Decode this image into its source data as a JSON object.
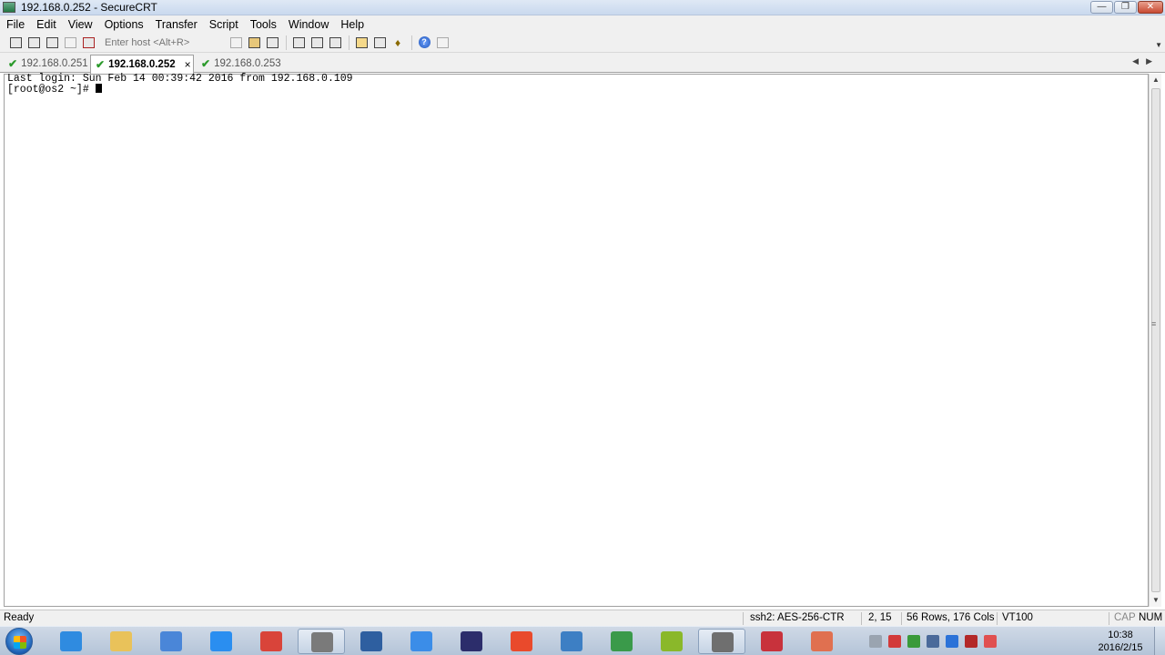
{
  "window": {
    "title": "192.168.0.252 - SecureCRT"
  },
  "menu": [
    "File",
    "Edit",
    "View",
    "Options",
    "Transfer",
    "Script",
    "Tools",
    "Window",
    "Help"
  ],
  "toolbar": {
    "host_placeholder": "Enter host <Alt+R>"
  },
  "tabs": [
    {
      "label": "192.168.0.251",
      "active": false
    },
    {
      "label": "192.168.0.252",
      "active": true,
      "close": "×"
    },
    {
      "label": "192.168.0.253",
      "active": false
    }
  ],
  "terminal": {
    "lines": [
      "Last login: Sun Feb 14 00:39:42 2016 from 192.168.0.109",
      "[root@os2 ~]# "
    ]
  },
  "status": {
    "ready": "Ready",
    "cipher": "ssh2: AES-256-CTR",
    "position": "2,  15",
    "size": "56 Rows, 176 Cols",
    "emulation": "VT100",
    "cap": "CAP",
    "num": "NUM"
  },
  "clock": {
    "time": "10:38",
    "date": "2016/2/15"
  },
  "taskbar_apps": [
    {
      "name": "ie-icon",
      "color": "#2f8be0",
      "open": false
    },
    {
      "name": "explorer-icon",
      "color": "#e9c25a",
      "open": false
    },
    {
      "name": "media-player-icon",
      "color": "#4a86d8",
      "open": false
    },
    {
      "name": "baidu-cloud-icon",
      "color": "#2a8ef0",
      "open": false
    },
    {
      "name": "chrome-icon",
      "color": "#d9443a",
      "open": false
    },
    {
      "name": "securefx-icon",
      "color": "#7a7a7a",
      "open": true
    },
    {
      "name": "lock-app-icon",
      "color": "#2e5fa0",
      "open": false
    },
    {
      "name": "notes-icon",
      "color": "#3b8de8",
      "open": false
    },
    {
      "name": "eclipse-icon",
      "color": "#2c2d6b",
      "open": false
    },
    {
      "name": "sketch-app-icon",
      "color": "#e94a2c",
      "open": false
    },
    {
      "name": "virtualbox-icon",
      "color": "#3d7fc4",
      "open": false
    },
    {
      "name": "publisher-icon",
      "color": "#3a9a4a",
      "open": false
    },
    {
      "name": "mindmanager-icon",
      "color": "#8ab82a",
      "open": false
    },
    {
      "name": "securecrt-icon",
      "color": "#6f6f6f",
      "open": true
    },
    {
      "name": "xmind-icon",
      "color": "#c8323c",
      "open": false
    },
    {
      "name": "paint-app-icon",
      "color": "#e07050",
      "open": false
    }
  ],
  "tray_icons": [
    {
      "name": "keyboard-icon",
      "color": "#9aa4b0"
    },
    {
      "name": "security-icon",
      "color": "#d23a3a"
    },
    {
      "name": "network-share-icon",
      "color": "#3a9a3a"
    },
    {
      "name": "windows-icon",
      "color": "#4a6a9a"
    },
    {
      "name": "bluetooth-icon",
      "color": "#2a72d8"
    },
    {
      "name": "antivirus-icon",
      "color": "#b32828"
    },
    {
      "name": "app-tray-icon",
      "color": "#e05050"
    }
  ]
}
